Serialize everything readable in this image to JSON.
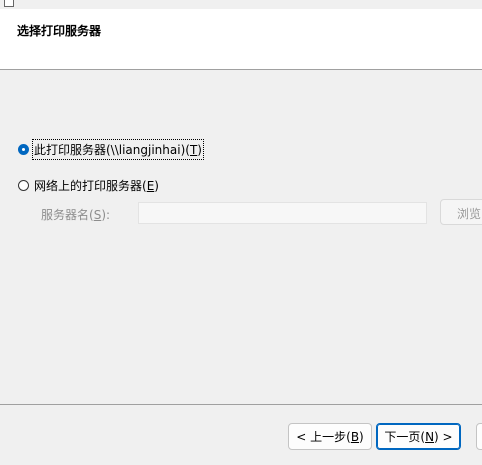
{
  "header": {
    "title": "选择打印服务器"
  },
  "options": {
    "this_server": {
      "label_prefix": "此打印服务器(\\\\liangjinhai)(",
      "accel": "T",
      "label_suffix": ")",
      "checked": true
    },
    "network_server": {
      "label_prefix": "网络上的打印服务器(",
      "accel": "E",
      "label_suffix": ")",
      "checked": false
    }
  },
  "server_name": {
    "label_prefix": "服务器名(",
    "accel": "S",
    "label_suffix": "):",
    "value": ""
  },
  "browse": {
    "label": "浏览"
  },
  "footer": {
    "back": {
      "prefix": "< 上一步(",
      "accel": "B",
      "suffix": ")"
    },
    "next": {
      "prefix": "下一页(",
      "accel": "N",
      "suffix": ") >"
    }
  },
  "colors": {
    "accent": "#0067c0",
    "disabled_text": "#8d8d8d"
  }
}
